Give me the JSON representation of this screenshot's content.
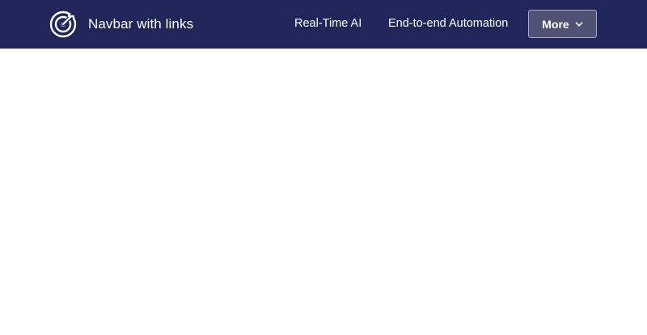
{
  "navbar": {
    "brand": {
      "title": "Navbar with links",
      "icon": "target-icon"
    },
    "links": [
      {
        "label": "Real-Time AI"
      },
      {
        "label": "End-to-end Automation"
      }
    ],
    "more_button": {
      "label": "More",
      "icon": "chevron-down-icon"
    }
  },
  "colors": {
    "navbar_background": "#20265a",
    "button_background": "#4f5274",
    "button_border": "#a9abc2",
    "text": "#ffffff",
    "page_background": "#ffffff"
  }
}
